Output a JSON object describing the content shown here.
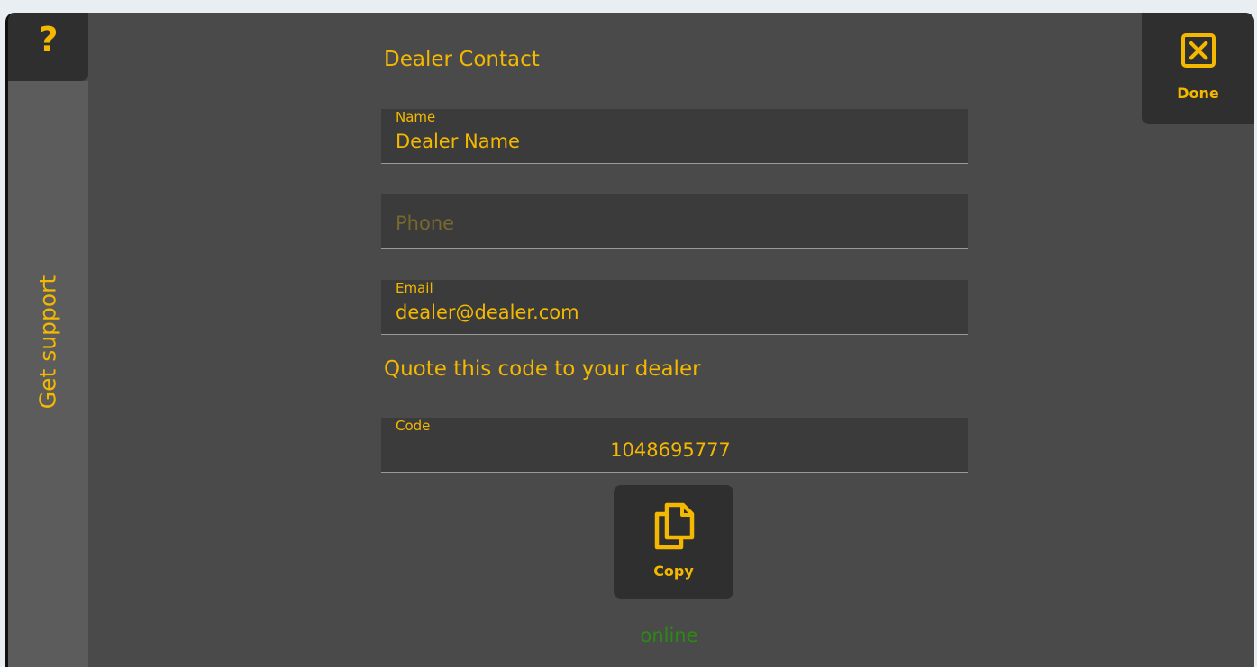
{
  "help": {
    "label": "?"
  },
  "sidebar": {
    "title": "Get support"
  },
  "done": {
    "label": "Done",
    "icon": "close-box-icon"
  },
  "dealer_contact": {
    "title": "Dealer Contact",
    "name": {
      "label": "Name",
      "value": "Dealer Name"
    },
    "phone": {
      "label": "",
      "value": "",
      "placeholder": "Phone"
    },
    "email": {
      "label": "Email",
      "value": "dealer@dealer.com"
    }
  },
  "quote": {
    "title": "Quote this code to your dealer",
    "code": {
      "label": "Code",
      "value": "1048695777"
    }
  },
  "copy": {
    "label": "Copy",
    "icon": "copy-icon"
  },
  "status": {
    "text": "online"
  },
  "colors": {
    "accent": "#f4b800",
    "background": "#4a4a4a",
    "panel": "#2f2f2f",
    "field": "#3b3b3b",
    "status_online": "#2a8a13"
  }
}
